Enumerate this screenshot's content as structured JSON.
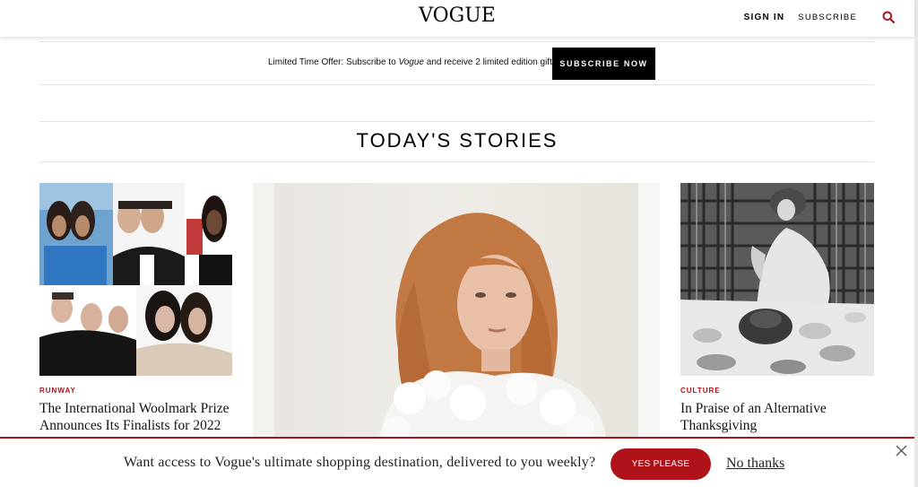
{
  "header": {
    "logo": "VOGUE",
    "sign_in": "SIGN IN",
    "subscribe": "SUBSCRIBE",
    "search_icon": "search-icon"
  },
  "promo": {
    "text_before": "Limited Time Offer: Subscribe to ",
    "text_italic": "Vogue",
    "text_after": " and receive 2 limited edition gifts",
    "button": "SUBSCRIBE NOW"
  },
  "section": {
    "title": "TODAY'S STORIES"
  },
  "stories": [
    {
      "category": "RUNWAY",
      "headline_line1": "The International Woolmark Prize",
      "headline_line2": "Announces Its Finalists for 2022"
    },
    {
      "category": "",
      "headline_line1": "",
      "headline_line2": ""
    },
    {
      "category": "CULTURE",
      "headline_line1": "In Praise of an Alternative",
      "headline_line2": "Thanksgiving"
    }
  ],
  "bottom_bar": {
    "text": "Want access to Vogue's ultimate shopping destination, delivered to you weekly?",
    "yes": "YES PLEASE",
    "no": "No thanks",
    "close_icon": "close-icon"
  },
  "colors": {
    "accent": "#b0121a",
    "button_dark": "#000000"
  }
}
